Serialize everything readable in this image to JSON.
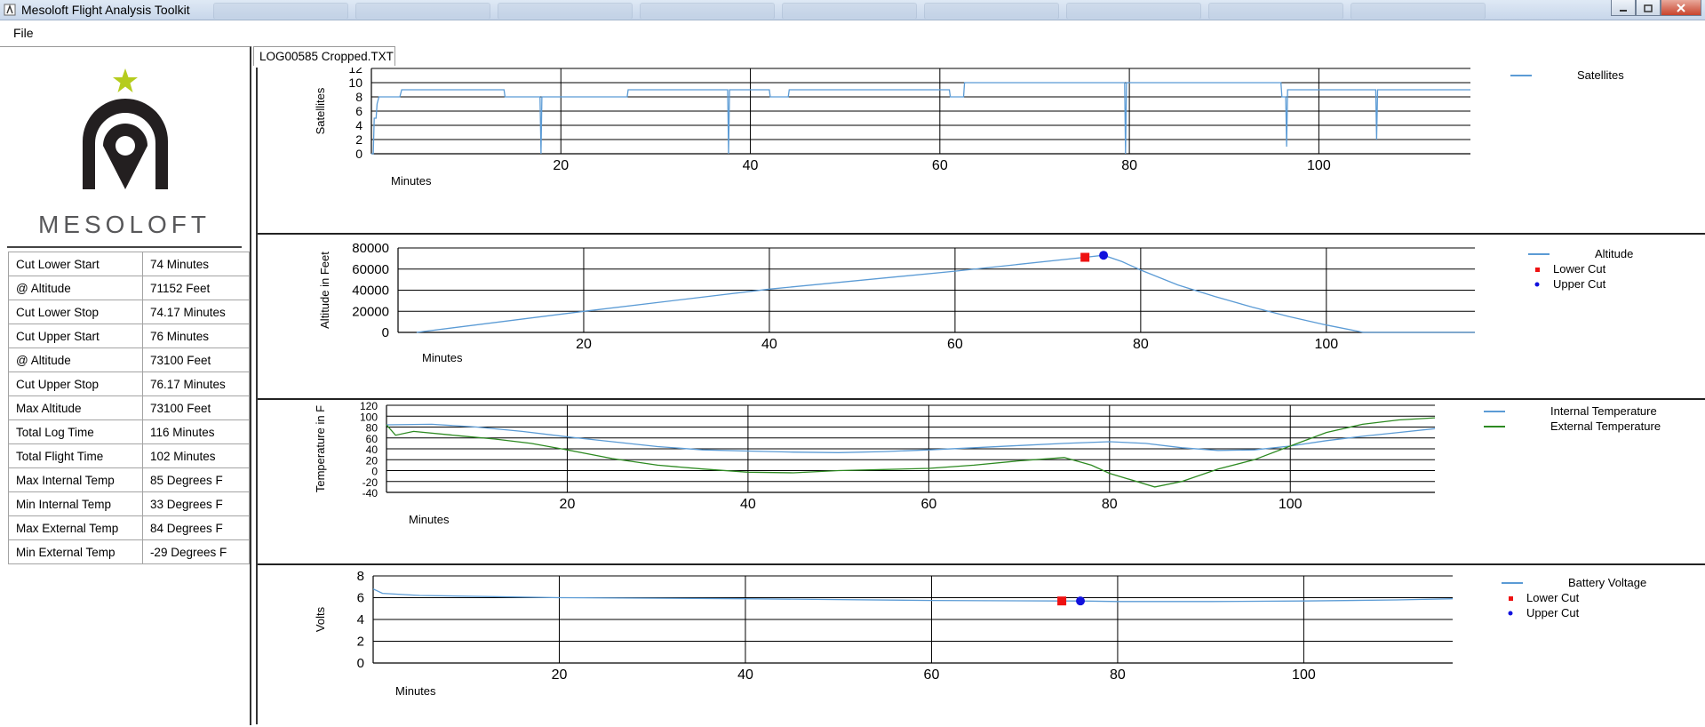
{
  "window": {
    "title": "Mesoloft Flight Analysis Toolkit",
    "accent": "#5a9bd8"
  },
  "menu": {
    "file": "File"
  },
  "logo": {
    "text": "MESOLOFT",
    "star_color": "#b5cc1e"
  },
  "stats": [
    {
      "label": "Cut Lower Start",
      "value": "74 Minutes"
    },
    {
      "label": "@ Altitude",
      "value": "71152 Feet"
    },
    {
      "label": "Cut Lower Stop",
      "value": "74.17 Minutes"
    },
    {
      "label": "Cut Upper Start",
      "value": "76 Minutes"
    },
    {
      "label": "@ Altitude",
      "value": "73100 Feet"
    },
    {
      "label": "Cut Upper Stop",
      "value": "76.17 Minutes"
    },
    {
      "label": "Max Altitude",
      "value": "73100 Feet"
    },
    {
      "label": "Total Log Time",
      "value": "116 Minutes"
    },
    {
      "label": "Total Flight Time",
      "value": "102 Minutes"
    },
    {
      "label": "Max Internal Temp",
      "value": "85 Degrees F"
    },
    {
      "label": "Min Internal Temp",
      "value": "33 Degrees F"
    },
    {
      "label": "Max External Temp",
      "value": "84 Degrees F"
    },
    {
      "label": "Min External Temp",
      "value": "-29 Degrees F"
    }
  ],
  "tab": {
    "label": "LOG00585 Cropped.TXT"
  },
  "chart_data": [
    {
      "type": "line",
      "ylabel": "Satellites",
      "xlabel": "Minutes",
      "xlim": [
        0,
        116
      ],
      "ylim": [
        0,
        12
      ],
      "xticks": [
        20,
        40,
        60,
        80,
        100
      ],
      "yticks": [
        0,
        2,
        4,
        6,
        8,
        10,
        12
      ],
      "legend_position": "top-right",
      "grid": true,
      "series": [
        {
          "name": "Satellites",
          "color": "#5b9bd5",
          "points": [
            [
              0,
              0
            ],
            [
              0.2,
              0
            ],
            [
              0.3,
              5
            ],
            [
              0.5,
              5
            ],
            [
              0.6,
              7
            ],
            [
              0.8,
              8
            ],
            [
              2,
              8
            ],
            [
              2.2,
              8
            ],
            [
              3,
              8
            ],
            [
              3.2,
              9
            ],
            [
              9,
              9
            ],
            [
              14,
              9
            ],
            [
              14.1,
              8
            ],
            [
              17.8,
              8
            ],
            [
              17.9,
              0
            ],
            [
              18,
              8
            ],
            [
              27,
              8
            ],
            [
              27.1,
              9
            ],
            [
              37.6,
              9
            ],
            [
              37.7,
              0
            ],
            [
              37.8,
              9
            ],
            [
              42,
              9
            ],
            [
              42.1,
              8
            ],
            [
              44,
              8
            ],
            [
              44.1,
              9
            ],
            [
              61,
              9
            ],
            [
              61.1,
              8
            ],
            [
              62.5,
              8
            ],
            [
              62.6,
              10
            ],
            [
              79.5,
              10
            ],
            [
              79.6,
              0
            ],
            [
              79.7,
              10
            ],
            [
              96,
              10
            ],
            [
              96.1,
              8
            ],
            [
              96.5,
              8
            ],
            [
              96.6,
              1
            ],
            [
              96.7,
              9
            ],
            [
              106,
              9
            ],
            [
              106.1,
              2
            ],
            [
              106.2,
              9
            ],
            [
              116,
              9
            ]
          ]
        }
      ]
    },
    {
      "type": "line",
      "ylabel": "Altitude in Feet",
      "xlabel": "Minutes",
      "xlim": [
        0,
        116
      ],
      "ylim": [
        0,
        80000
      ],
      "xticks": [
        20,
        40,
        60,
        80,
        100
      ],
      "yticks": [
        0,
        20000,
        40000,
        60000,
        80000
      ],
      "legend_position": "top-right",
      "grid": true,
      "series": [
        {
          "name": "Altitude",
          "color": "#5b9bd5",
          "points": [
            [
              2,
              0
            ],
            [
              20,
              20000
            ],
            [
              40,
              41000
            ],
            [
              60,
              58000
            ],
            [
              74,
              71152
            ],
            [
              76,
              73100
            ],
            [
              78,
              67000
            ],
            [
              80,
              59000
            ],
            [
              84,
              45000
            ],
            [
              88,
              34000
            ],
            [
              92,
              24000
            ],
            [
              96,
              15000
            ],
            [
              100,
              7000
            ],
            [
              104,
              0
            ],
            [
              116,
              0
            ]
          ]
        },
        {
          "name": "Lower Cut",
          "color": "#ee1111",
          "marker": "square",
          "points": [
            [
              74,
              71152
            ]
          ]
        },
        {
          "name": "Upper Cut",
          "color": "#1111dd",
          "marker": "circle",
          "points": [
            [
              76,
              73100
            ]
          ]
        }
      ]
    },
    {
      "type": "line",
      "ylabel": "Temperature in F",
      "xlabel": "Minutes",
      "xlim": [
        0,
        116
      ],
      "ylim": [
        -40,
        120
      ],
      "xticks": [
        20,
        40,
        60,
        80,
        100
      ],
      "yticks": [
        -40,
        -20,
        0,
        20,
        40,
        60,
        80,
        100,
        120
      ],
      "legend_position": "top-right",
      "grid": true,
      "series": [
        {
          "name": "Internal Temperature",
          "color": "#5b9bd5",
          "points": [
            [
              0,
              84
            ],
            [
              5,
              85
            ],
            [
              10,
              80
            ],
            [
              15,
              72
            ],
            [
              20,
              62
            ],
            [
              25,
              53
            ],
            [
              30,
              44
            ],
            [
              35,
              38
            ],
            [
              40,
              36
            ],
            [
              45,
              34
            ],
            [
              50,
              33
            ],
            [
              55,
              35
            ],
            [
              60,
              38
            ],
            [
              65,
              42
            ],
            [
              70,
              46
            ],
            [
              75,
              50
            ],
            [
              80,
              53
            ],
            [
              84,
              50
            ],
            [
              88,
              42
            ],
            [
              92,
              37
            ],
            [
              96,
              38
            ],
            [
              100,
              45
            ],
            [
              104,
              55
            ],
            [
              108,
              63
            ],
            [
              112,
              70
            ],
            [
              116,
              77
            ]
          ]
        },
        {
          "name": "External Temperature",
          "color": "#2d8a21",
          "points": [
            [
              0,
              84
            ],
            [
              1,
              65
            ],
            [
              3,
              72
            ],
            [
              8,
              64
            ],
            [
              12,
              58
            ],
            [
              16,
              50
            ],
            [
              20,
              38
            ],
            [
              25,
              22
            ],
            [
              30,
              10
            ],
            [
              35,
              3
            ],
            [
              40,
              -3
            ],
            [
              45,
              -4
            ],
            [
              50,
              0
            ],
            [
              55,
              2
            ],
            [
              60,
              4
            ],
            [
              65,
              10
            ],
            [
              70,
              18
            ],
            [
              75,
              24
            ],
            [
              78,
              10
            ],
            [
              80,
              -5
            ],
            [
              82,
              -15
            ],
            [
              85,
              -30
            ],
            [
              88,
              -20
            ],
            [
              92,
              3
            ],
            [
              96,
              20
            ],
            [
              100,
              45
            ],
            [
              104,
              70
            ],
            [
              108,
              85
            ],
            [
              112,
              93
            ],
            [
              116,
              97
            ]
          ]
        }
      ]
    },
    {
      "type": "line",
      "ylabel": "Volts",
      "xlabel": "Minutes",
      "xlim": [
        0,
        116
      ],
      "ylim": [
        0,
        8
      ],
      "xticks": [
        20,
        40,
        60,
        80,
        100
      ],
      "yticks": [
        0,
        2,
        4,
        6,
        8
      ],
      "legend_position": "top-right",
      "grid": true,
      "series": [
        {
          "name": "Battery Voltage",
          "color": "#5b9bd5",
          "points": [
            [
              0,
              6.8
            ],
            [
              1,
              6.4
            ],
            [
              5,
              6.2
            ],
            [
              20,
              6.0
            ],
            [
              40,
              5.9
            ],
            [
              60,
              5.75
            ],
            [
              74,
              5.7
            ],
            [
              76,
              5.7
            ],
            [
              80,
              5.65
            ],
            [
              90,
              5.65
            ],
            [
              100,
              5.7
            ],
            [
              110,
              5.8
            ],
            [
              116,
              5.9
            ]
          ]
        },
        {
          "name": "Lower Cut",
          "color": "#ee1111",
          "marker": "square",
          "points": [
            [
              74,
              5.7
            ]
          ]
        },
        {
          "name": "Upper Cut",
          "color": "#1111dd",
          "marker": "circle",
          "points": [
            [
              76,
              5.7
            ]
          ]
        }
      ]
    }
  ]
}
